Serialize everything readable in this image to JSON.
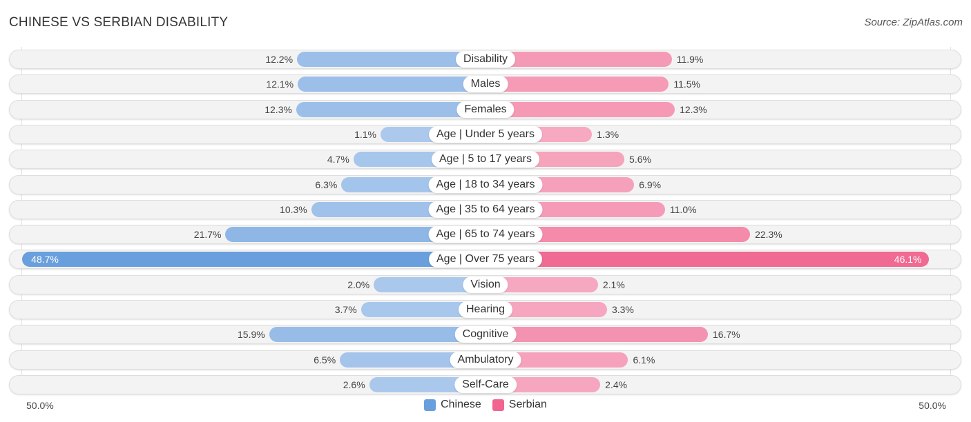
{
  "header": {
    "title": "CHINESE VS SERBIAN DISABILITY",
    "source": "Source: ZipAtlas.com"
  },
  "chart_data": {
    "type": "bar",
    "orientation": "horizontal-diverging",
    "title": "CHINESE VS SERBIAN DISABILITY",
    "categories": [
      "Disability",
      "Males",
      "Females",
      "Age | Under 5 years",
      "Age | 5 to 17 years",
      "Age | 18 to 34 years",
      "Age | 35 to 64 years",
      "Age | 65 to 74 years",
      "Age | Over 75 years",
      "Vision",
      "Hearing",
      "Cognitive",
      "Ambulatory",
      "Self-Care"
    ],
    "series": [
      {
        "name": "Chinese",
        "color": "#6a9fde",
        "values": [
          12.2,
          12.1,
          12.3,
          1.1,
          4.7,
          6.3,
          10.3,
          21.7,
          48.7,
          2.0,
          3.7,
          15.9,
          6.5,
          2.6
        ],
        "labels": [
          "12.2%",
          "12.1%",
          "12.3%",
          "1.1%",
          "4.7%",
          "6.3%",
          "10.3%",
          "21.7%",
          "48.7%",
          "2.0%",
          "3.7%",
          "15.9%",
          "6.5%",
          "2.6%"
        ]
      },
      {
        "name": "Serbian",
        "color": "#f06690",
        "values": [
          11.9,
          11.5,
          12.3,
          1.3,
          5.6,
          6.9,
          11.0,
          22.3,
          46.1,
          2.1,
          3.3,
          16.7,
          6.1,
          2.4
        ],
        "labels": [
          "11.9%",
          "11.5%",
          "12.3%",
          "1.3%",
          "5.6%",
          "6.9%",
          "11.0%",
          "22.3%",
          "46.1%",
          "2.1%",
          "3.3%",
          "16.7%",
          "6.1%",
          "2.4%"
        ]
      }
    ],
    "xlim": [
      -50,
      50
    ],
    "axis_labels": {
      "left": "50.0%",
      "right": "50.0%"
    },
    "legend": {
      "position": "bottom-center",
      "entries": [
        "Chinese",
        "Serbian"
      ]
    },
    "unit": "%"
  }
}
